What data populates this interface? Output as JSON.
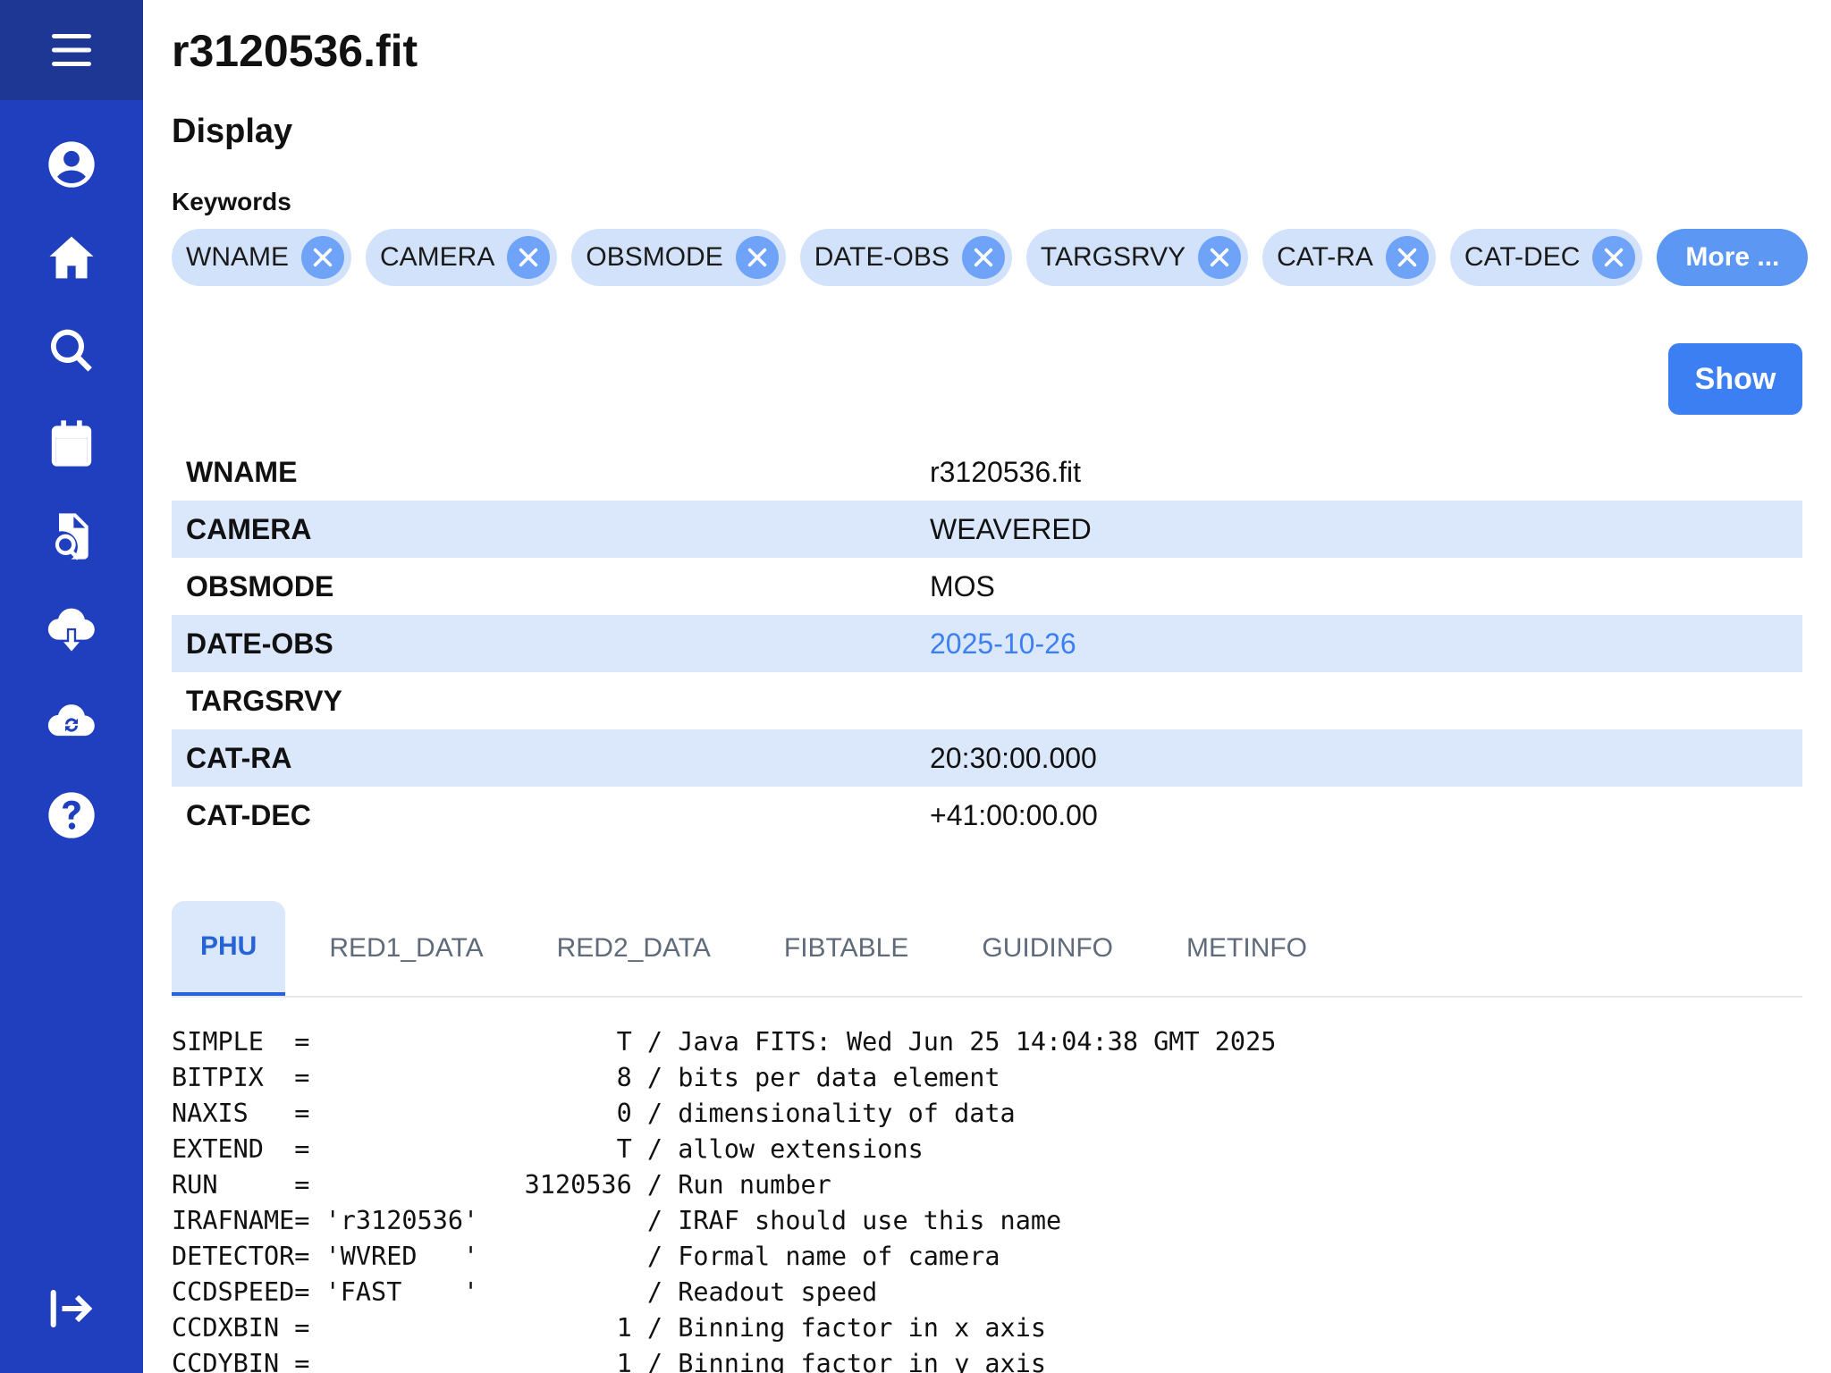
{
  "sidebar": {
    "icons": [
      "menu-icon",
      "user-icon",
      "home-icon",
      "search-icon",
      "calendar-icon",
      "file-search-icon",
      "cloud-download-icon",
      "cloud-sync-icon",
      "help-icon",
      "logout-icon"
    ]
  },
  "page": {
    "title": "r3120536.fit",
    "section": "Display",
    "keywords_label": "Keywords"
  },
  "keywords": [
    "WNAME",
    "CAMERA",
    "OBSMODE",
    "DATE-OBS",
    "TARGSRVY",
    "CAT-RA",
    "CAT-DEC"
  ],
  "more_label": "More ...",
  "show_label": "Show",
  "table": [
    {
      "key": "WNAME",
      "value": "r3120536.fit"
    },
    {
      "key": "CAMERA",
      "value": "WEAVERED"
    },
    {
      "key": "OBSMODE",
      "value": "MOS"
    },
    {
      "key": "DATE-OBS",
      "value": "2025-10-26"
    },
    {
      "key": "TARGSRVY",
      "value": ""
    },
    {
      "key": "CAT-RA",
      "value": "20:30:00.000"
    },
    {
      "key": "CAT-DEC",
      "value": "+41:00:00.00"
    }
  ],
  "tabs": [
    "PHU",
    "RED1_DATA",
    "RED2_DATA",
    "FIBTABLE",
    "GUIDINFO",
    "METINFO"
  ],
  "active_tab": "PHU",
  "header_lines": [
    "SIMPLE  =                    T / Java FITS: Wed Jun 25 14:04:38 GMT 2025",
    "BITPIX  =                    8 / bits per data element",
    "NAXIS   =                    0 / dimensionality of data",
    "EXTEND  =                    T / allow extensions",
    "RUN     =              3120536 / Run number",
    "IRAFNAME= 'r3120536'           / IRAF should use this name",
    "DETECTOR= 'WVRED   '           / Formal name of camera",
    "CCDSPEED= 'FAST    '           / Readout speed",
    "CCDXBIN =                    1 / Binning factor in x axis",
    "CCDYBIN =                    1 / Binning factor in y axis"
  ],
  "colors": {
    "sidebar": "#1f3fbf",
    "sidebar_top": "#1e3694",
    "chip_bg": "#d3e2fb",
    "chip_x": "#6ea3f7",
    "primary": "#3b7ff2",
    "row_alt": "#dbe8fc"
  }
}
